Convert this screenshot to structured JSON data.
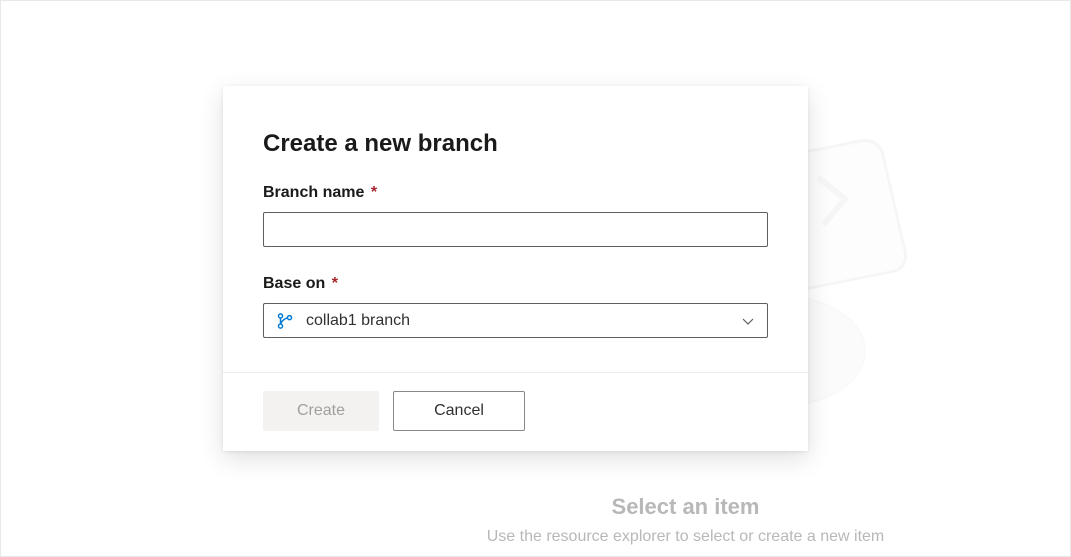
{
  "backdrop": {
    "title": "Select an item",
    "subtitle": "Use the resource explorer to select or create a new item"
  },
  "dialog": {
    "title": "Create a new branch",
    "branch_name": {
      "label": "Branch name",
      "required_marker": "*",
      "value": ""
    },
    "base_on": {
      "label": "Base on",
      "required_marker": "*",
      "selected": "collab1 branch"
    },
    "footer": {
      "create_label": "Create",
      "cancel_label": "Cancel"
    }
  }
}
